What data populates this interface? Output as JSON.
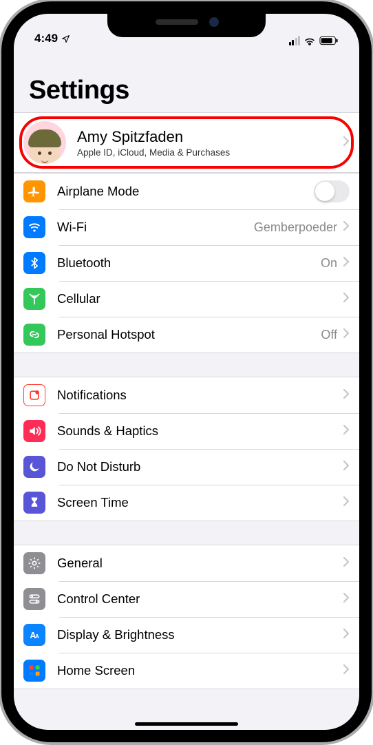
{
  "status_bar": {
    "time": "4:49",
    "location_active": true,
    "signal_bars_filled": 2,
    "signal_bars_total": 4,
    "wifi_on": true,
    "battery_approx_pct": 80
  },
  "title": "Settings",
  "profile": {
    "name": "Amy Spitzfaden",
    "subtitle": "Apple ID, iCloud, Media & Purchases",
    "highlighted": true
  },
  "groups": [
    [
      {
        "id": "airplane-mode",
        "icon": "airplane",
        "icon_bg": "bg-orange",
        "label": "Airplane Mode",
        "type": "toggle",
        "on": false
      },
      {
        "id": "wifi",
        "icon": "wifi",
        "icon_bg": "bg-blue",
        "label": "Wi-Fi",
        "type": "link",
        "value": "Gemberpoeder"
      },
      {
        "id": "bluetooth",
        "icon": "bluetooth",
        "icon_bg": "bg-blue",
        "label": "Bluetooth",
        "type": "link",
        "value": "On"
      },
      {
        "id": "cellular",
        "icon": "antenna",
        "icon_bg": "bg-green",
        "label": "Cellular",
        "type": "link"
      },
      {
        "id": "personal-hotspot",
        "icon": "chain",
        "icon_bg": "bg-green",
        "label": "Personal Hotspot",
        "type": "link",
        "value": "Off"
      }
    ],
    [
      {
        "id": "notifications",
        "icon": "bell-sq",
        "icon_bg": "bg-white-b",
        "label": "Notifications",
        "type": "link"
      },
      {
        "id": "sounds-haptics",
        "icon": "speaker",
        "icon_bg": "bg-pink",
        "label": "Sounds & Haptics",
        "type": "link"
      },
      {
        "id": "do-not-disturb",
        "icon": "moon",
        "icon_bg": "bg-purple",
        "label": "Do Not Disturb",
        "type": "link"
      },
      {
        "id": "screen-time",
        "icon": "hourglass",
        "icon_bg": "bg-purple",
        "label": "Screen Time",
        "type": "link"
      }
    ],
    [
      {
        "id": "general",
        "icon": "gear",
        "icon_bg": "bg-gray",
        "label": "General",
        "type": "link"
      },
      {
        "id": "control-center",
        "icon": "switches",
        "icon_bg": "bg-gray",
        "label": "Control Center",
        "type": "link"
      },
      {
        "id": "display-brightness",
        "icon": "aa",
        "icon_bg": "bg-lightblue",
        "label": "Display & Brightness",
        "type": "link"
      },
      {
        "id": "home-screen",
        "icon": "grid",
        "icon_bg": "bg-blue",
        "label": "Home Screen",
        "type": "link"
      }
    ]
  ]
}
